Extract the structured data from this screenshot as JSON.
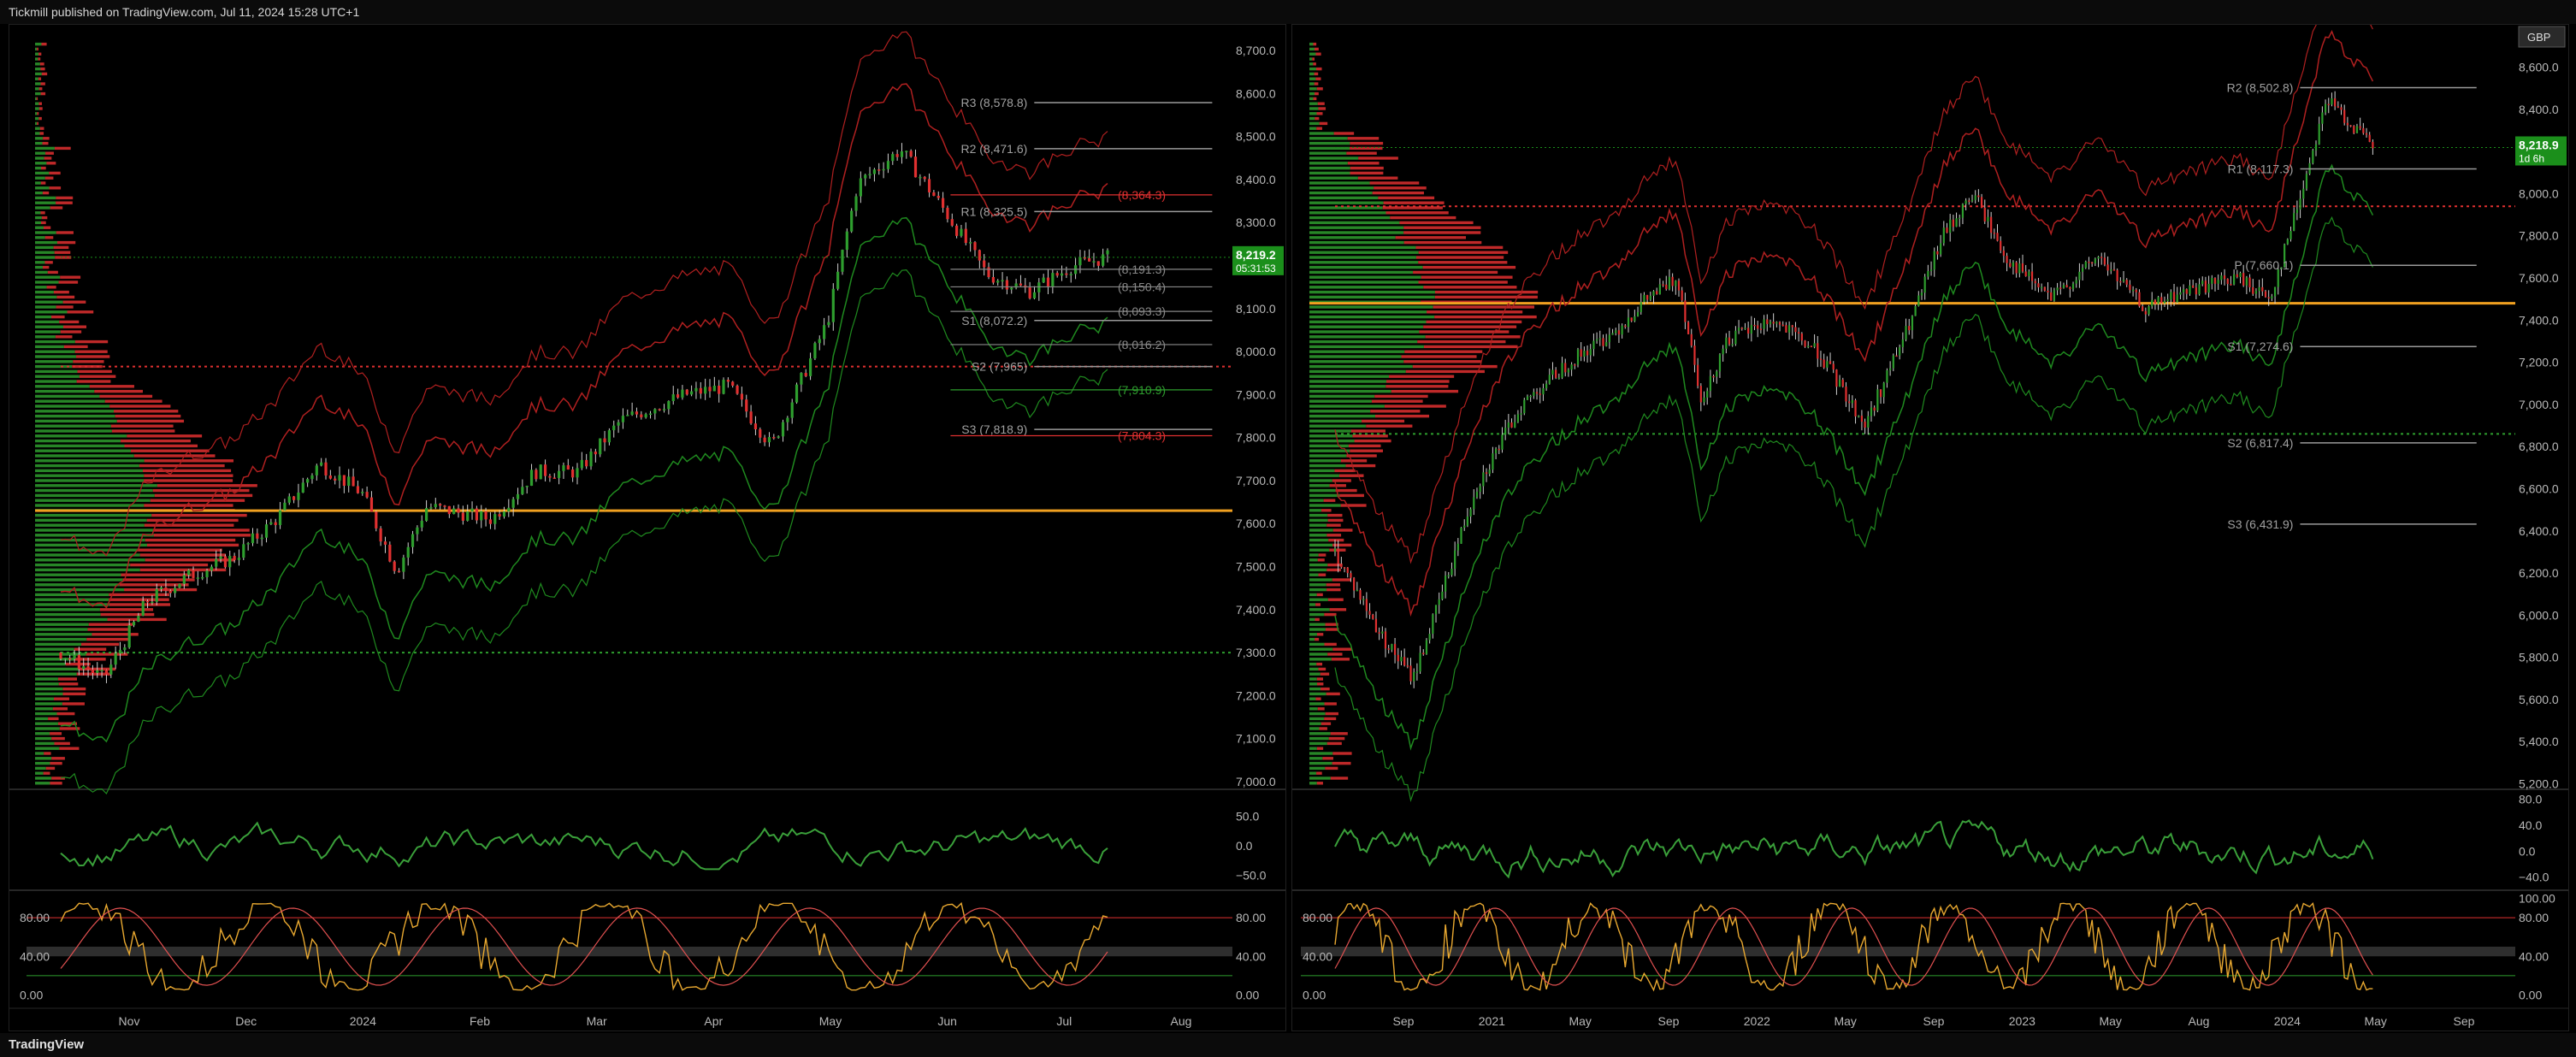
{
  "header": {
    "publisher_text": "Tickmill published on TradingView.com, Jul 11, 2024 15:28 UTC+1"
  },
  "footer": {
    "logo_text": "TradingView"
  },
  "colors": {
    "up": "#2e9e2e",
    "down": "#e03030",
    "pivot_line": "#9a9a9a",
    "poc": "#f0a020",
    "price_badge": "#1b8f1b",
    "currency_badge": "#2a2a2a"
  },
  "chart_data": [
    {
      "type": "candlestick",
      "panel": "left",
      "x_tick_labels": [
        "Nov",
        "Dec",
        "2024",
        "Feb",
        "Mar",
        "Apr",
        "May",
        "Jun",
        "Jul",
        "Aug"
      ],
      "y_tick_labels": [
        "8,700.0",
        "8,600.0",
        "8,500.0",
        "8,400.0",
        "8,300.0",
        "8,200.0",
        "8,100.0",
        "8,000.0",
        "7,900.0",
        "7,800.0",
        "7,700.0",
        "7,600.0",
        "7,500.0",
        "7,400.0",
        "7,300.0",
        "7,200.0",
        "7,100.0",
        "7,000.0"
      ],
      "y_range": [
        6990,
        8720
      ],
      "last_price": {
        "value": "8,219.2",
        "countdown": "05:31:53"
      },
      "close_path": [
        [
          0,
          7300
        ],
        [
          10,
          7240
        ],
        [
          20,
          7420
        ],
        [
          30,
          7480
        ],
        [
          40,
          7520
        ],
        [
          50,
          7610
        ],
        [
          60,
          7740
        ],
        [
          70,
          7670
        ],
        [
          78,
          7490
        ],
        [
          85,
          7640
        ],
        [
          100,
          7610
        ],
        [
          110,
          7720
        ],
        [
          120,
          7720
        ],
        [
          130,
          7840
        ],
        [
          145,
          7900
        ],
        [
          155,
          7920
        ],
        [
          165,
          7780
        ],
        [
          178,
          8070
        ],
        [
          185,
          8390
        ],
        [
          195,
          8470
        ],
        [
          205,
          8330
        ],
        [
          215,
          8180
        ],
        [
          225,
          8140
        ],
        [
          235,
          8200
        ],
        [
          243,
          8219.2
        ]
      ],
      "x_domain": [
        0,
        270
      ],
      "pivot_levels": [
        {
          "label": "R3 (8,578.8)",
          "value": 8578.8
        },
        {
          "label": "R2 (8,471.6)",
          "value": 8471.6
        },
        {
          "label": "R1 (8,325.5)",
          "value": 8325.5
        },
        {
          "label": "S1 (8,072.2)",
          "value": 8072.2
        },
        {
          "label": "S2 (7,965)",
          "value": 7965
        },
        {
          "label": "S3 (7,818.9)",
          "value": 7818.9
        }
      ],
      "side_levels": [
        {
          "label": "(8,364.3)",
          "value": 8364.3,
          "color": "#e03030"
        },
        {
          "label": "(8,191.3)",
          "value": 8191.3,
          "color": "#888888"
        },
        {
          "label": "(8,150.4)",
          "value": 8150.4,
          "color": "#888888"
        },
        {
          "label": "(8,093.3)",
          "value": 8093.3,
          "color": "#888888"
        },
        {
          "label": "(8,016.2)",
          "value": 8016.2,
          "color": "#888888"
        },
        {
          "label": "(7,910.9)",
          "value": 7910.9,
          "color": "#2e9e2e"
        },
        {
          "label": "(7,804.3)",
          "value": 7804.3,
          "color": "#e03030"
        }
      ],
      "poc_level": 7630,
      "hline_dotted_red": 7965,
      "hline_dotted_green": 7300,
      "oscillator": {
        "y_tick_labels": [
          "50.0",
          "0.0",
          "−50.0"
        ],
        "y_range": [
          -70,
          90
        ]
      },
      "stochastic": {
        "y_tick_labels": [
          "80.00",
          "40.00",
          "0.00"
        ],
        "y_range": [
          -5,
          105
        ],
        "right_tick_labels": [
          "80.00",
          "40.00",
          "0.00"
        ]
      }
    },
    {
      "type": "candlestick",
      "panel": "right",
      "x_tick_labels": [
        "Sep",
        "2021",
        "May",
        "Sep",
        "2022",
        "May",
        "Sep",
        "2023",
        "May",
        "Aug",
        "2024",
        "May",
        "Sep"
      ],
      "y_tick_labels": [
        "8,600.0",
        "8,400.0",
        "8,200.0",
        "8,000.0",
        "7,800.0",
        "7,600.0",
        "7,400.0",
        "7,200.0",
        "7,000.0",
        "6,800.0",
        "6,600.0",
        "6,400.0",
        "6,200.0",
        "6,000.0",
        "5,800.0",
        "5,600.0",
        "5,400.0",
        "5,200.0"
      ],
      "y_range": [
        5190,
        8720
      ],
      "currency": "GBP",
      "last_price": {
        "value": "8,218.9",
        "countdown": "1d 6h"
      },
      "close_path": [
        [
          0,
          6300
        ],
        [
          15,
          5900
        ],
        [
          25,
          5700
        ],
        [
          32,
          6000
        ],
        [
          45,
          6600
        ],
        [
          60,
          7000
        ],
        [
          75,
          7200
        ],
        [
          90,
          7350
        ],
        [
          100,
          7500
        ],
        [
          110,
          7600
        ],
        [
          118,
          7000
        ],
        [
          125,
          7300
        ],
        [
          140,
          7400
        ],
        [
          155,
          7250
        ],
        [
          170,
          6900
        ],
        [
          185,
          7400
        ],
        [
          195,
          7800
        ],
        [
          205,
          8000
        ],
        [
          215,
          7700
        ],
        [
          230,
          7500
        ],
        [
          245,
          7700
        ],
        [
          260,
          7450
        ],
        [
          275,
          7550
        ],
        [
          290,
          7600
        ],
        [
          300,
          7500
        ],
        [
          310,
          8000
        ],
        [
          318,
          8450
        ],
        [
          325,
          8350
        ],
        [
          333,
          8218.9
        ]
      ],
      "x_domain": [
        0,
        365
      ],
      "pivot_levels": [
        {
          "label": "R2 (8,502.8)",
          "value": 8502.8
        },
        {
          "label": "R1 (8,117.3)",
          "value": 8117.3
        },
        {
          "label": "P (7,660.1)",
          "value": 7660.1
        },
        {
          "label": "S1 (7,274.6)",
          "value": 7274.6
        },
        {
          "label": "S2 (6,817.4)",
          "value": 6817.4
        },
        {
          "label": "S3 (6,431.9)",
          "value": 6431.9
        }
      ],
      "poc_level": 7480,
      "hline_dotted_red": 7940,
      "hline_dotted_green": 6860,
      "oscillator": {
        "y_tick_labels": [
          "80.0",
          "40.0",
          "0.0",
          "−40.0"
        ],
        "y_range": [
          -55,
          90
        ]
      },
      "stochastic": {
        "y_tick_labels": [
          "100.00",
          "80.00",
          "40.00",
          "0.00"
        ],
        "y_range": [
          -5,
          105
        ],
        "left_tick_labels": [
          "80.00",
          "40.00",
          "0.00"
        ]
      }
    }
  ]
}
